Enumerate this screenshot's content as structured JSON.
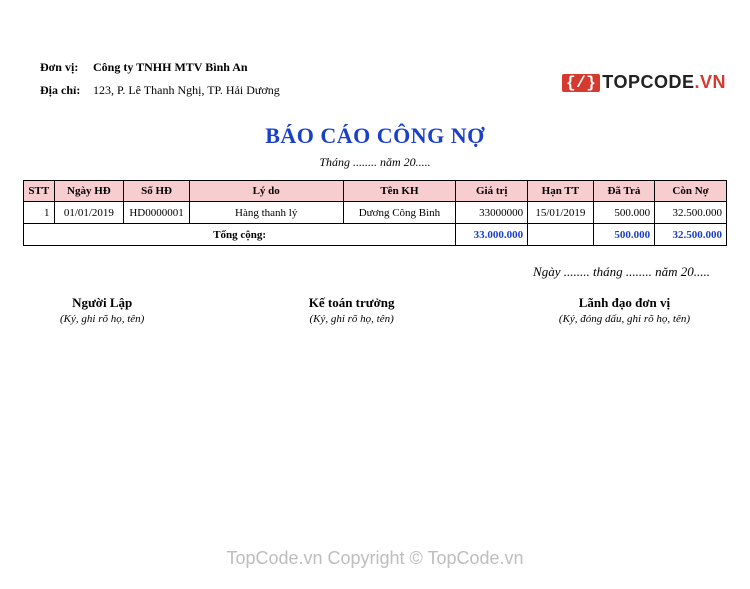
{
  "brand": {
    "logo_glyph": "{/}",
    "name": "TOPCODE",
    "tld": ".VN"
  },
  "meta": {
    "unit_label": "Đơn vị:",
    "unit_value": "Công ty TNHH MTV Bình An",
    "address_label": "Địa chỉ:",
    "address_value": "123, P. Lê Thanh Nghị, TP. Hải Dương"
  },
  "title": "BÁO CÁO CÔNG NỢ",
  "subtitle": "Tháng ........ năm 20.....",
  "columns": {
    "stt": "STT",
    "ngay_hd": "Ngày HĐ",
    "so_hd": "Số HĐ",
    "ly_do": "Lý do",
    "ten_kh": "Tên KH",
    "gia_tri": "Giá trị",
    "han_tt": "Hạn TT",
    "da_tra": "Đã Trả",
    "con_no": "Còn Nợ"
  },
  "rows": [
    {
      "stt": "1",
      "ngay_hd": "01/01/2019",
      "so_hd": "HD0000001",
      "ly_do": "Hàng thanh lý",
      "ten_kh": "Dương Công Bình",
      "gia_tri": "33000000",
      "han_tt": "15/01/2019",
      "da_tra": "500.000",
      "con_no": "32.500.000"
    }
  ],
  "total": {
    "label": "Tổng cộng:",
    "gia_tri": "33.000.000",
    "da_tra": "500.000",
    "con_no": "32.500.000"
  },
  "date_line": "Ngày ........ tháng ........ năm 20.....",
  "signatures": {
    "left": {
      "role": "Người Lập",
      "note": "(Ký, ghi rõ họ, tên)"
    },
    "center": {
      "role": "Kế toán trưởng",
      "note": "(Ký, ghi rõ họ, tên)"
    },
    "right": {
      "role": "Lãnh đạo đơn vị",
      "note": "(Ký, đóng dấu, ghi rõ họ, tên)"
    }
  },
  "watermark": "TopCode.vn   Copyright © TopCode.vn"
}
